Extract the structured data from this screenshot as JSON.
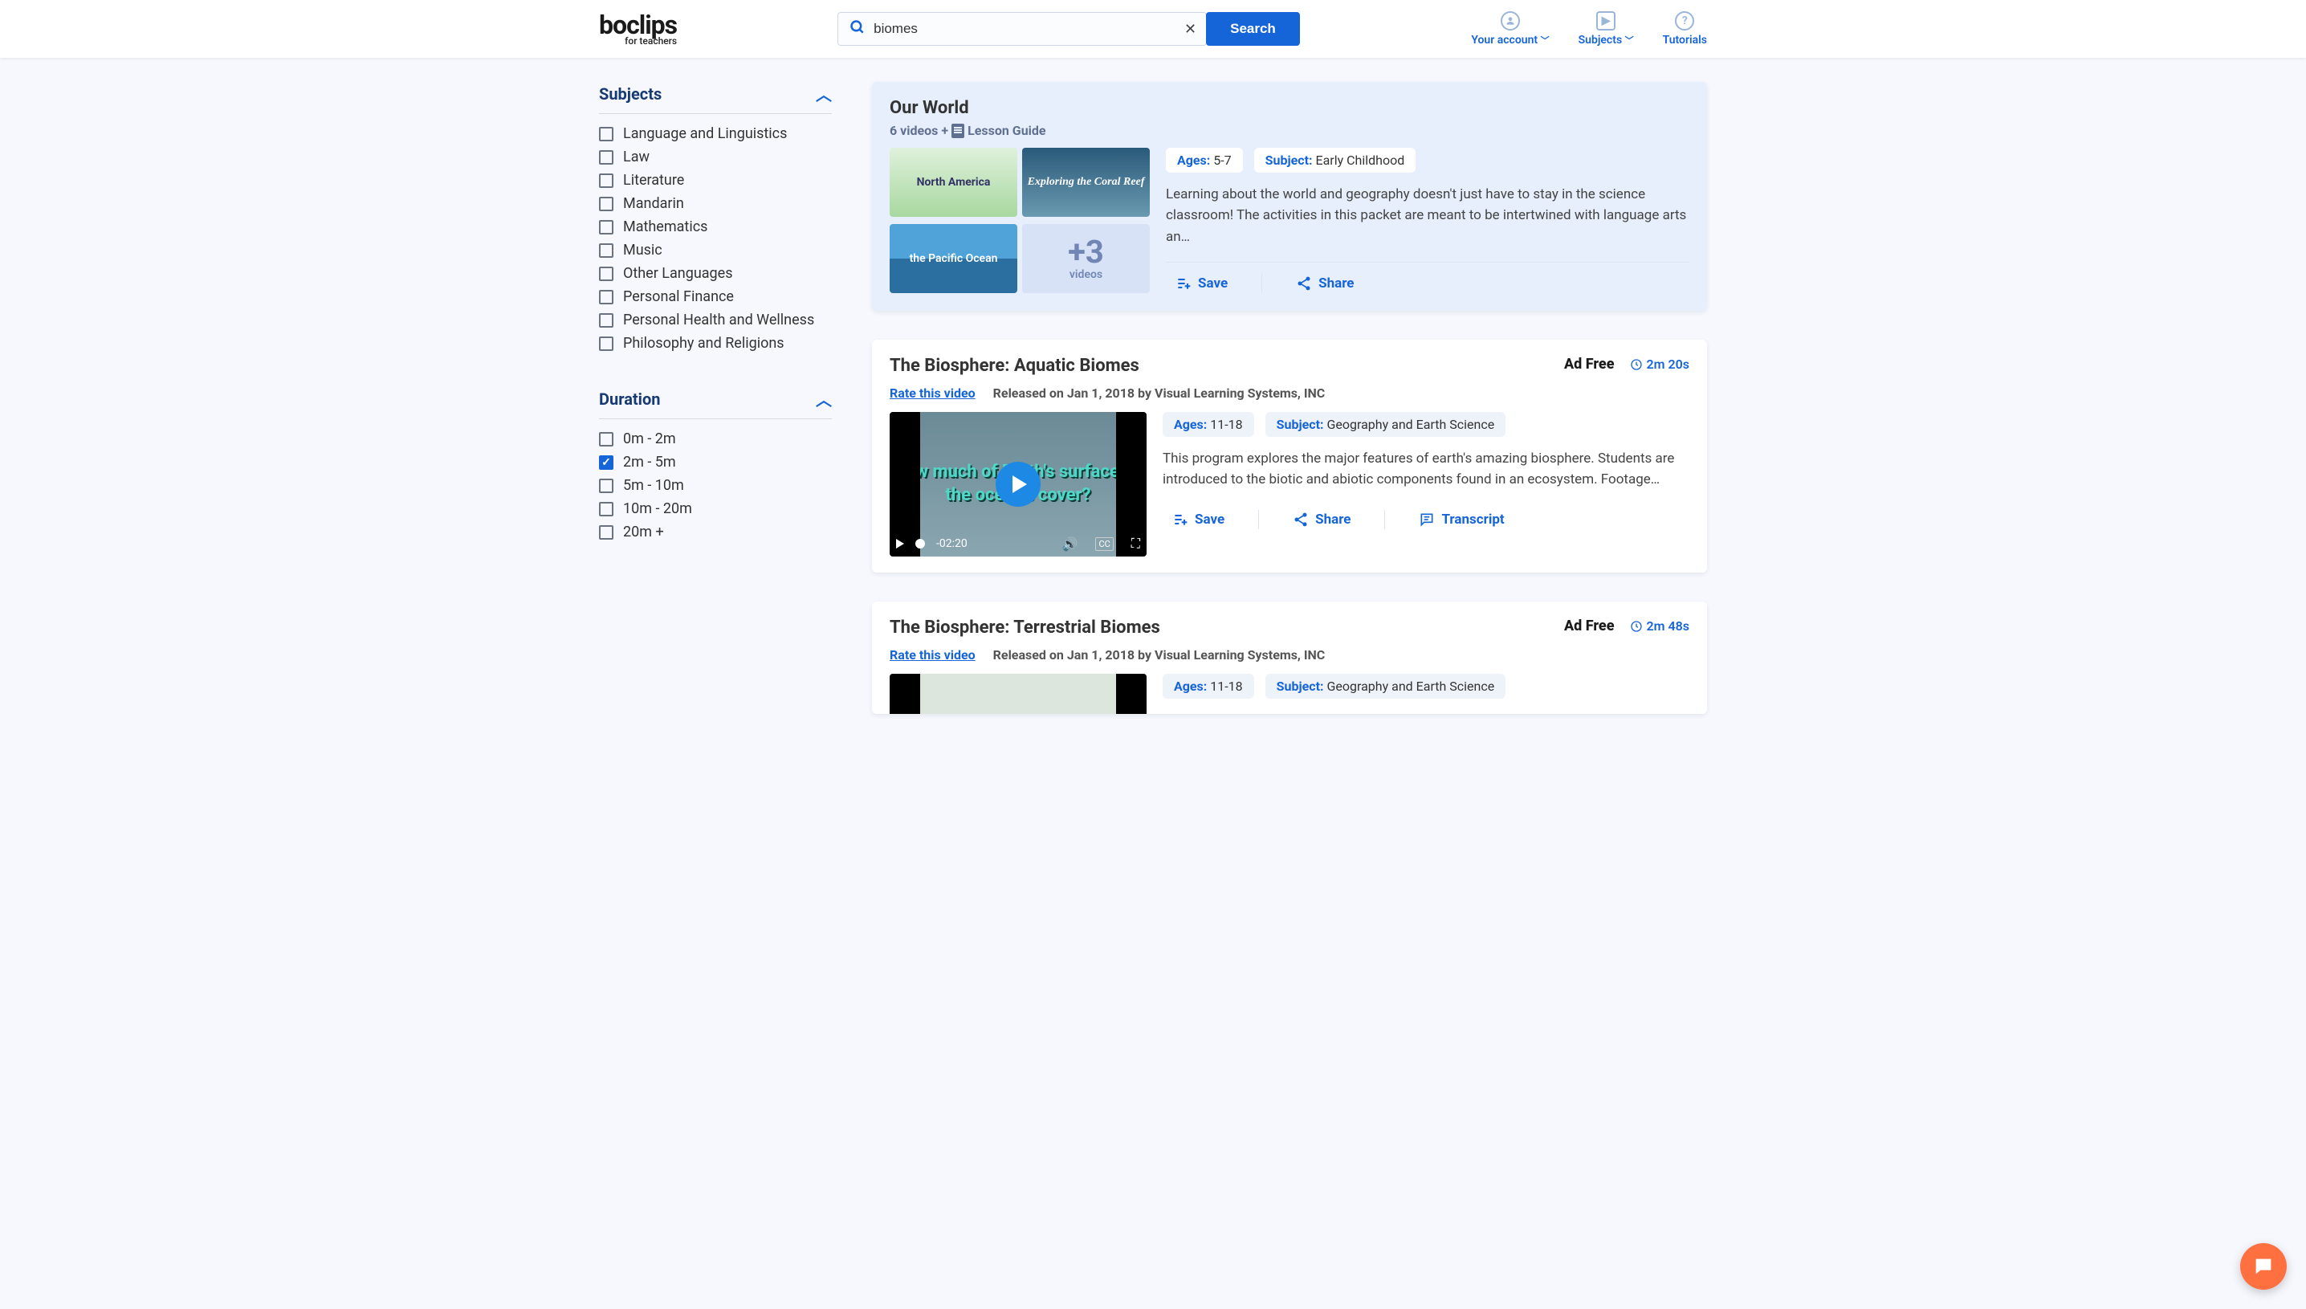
{
  "header": {
    "logo_main": "boclips",
    "logo_sub": "for teachers",
    "search_value": "biomes",
    "search_button": "Search",
    "nav": {
      "account": "Your account",
      "subjects": "Subjects",
      "tutorials": "Tutorials"
    }
  },
  "filters": {
    "subjects": {
      "title": "Subjects",
      "items": [
        {
          "label": "Language and Linguistics",
          "checked": false
        },
        {
          "label": "Law",
          "checked": false
        },
        {
          "label": "Literature",
          "checked": false
        },
        {
          "label": "Mandarin",
          "checked": false
        },
        {
          "label": "Mathematics",
          "checked": false
        },
        {
          "label": "Music",
          "checked": false
        },
        {
          "label": "Other Languages",
          "checked": false
        },
        {
          "label": "Personal Finance",
          "checked": false
        },
        {
          "label": "Personal Health and Wellness",
          "checked": false
        },
        {
          "label": "Philosophy and Religions",
          "checked": false
        }
      ]
    },
    "duration": {
      "title": "Duration",
      "items": [
        {
          "label": "0m - 2m",
          "checked": false
        },
        {
          "label": "2m - 5m",
          "checked": true
        },
        {
          "label": "5m - 10m",
          "checked": false
        },
        {
          "label": "10m - 20m",
          "checked": false
        },
        {
          "label": "20m +",
          "checked": false
        }
      ]
    }
  },
  "results": {
    "featured": {
      "title": "Our World",
      "subtitle_pre": "6 videos +",
      "subtitle_post": "Lesson Guide",
      "thumbs": [
        "North America",
        "Exploring the Coral Reef",
        "the Pacific Ocean"
      ],
      "more_count": "+3",
      "more_label": "videos",
      "ages_label": "Ages:",
      "ages_value": "5-7",
      "subject_label": "Subject:",
      "subject_value": "Early Childhood",
      "desc": "Learning about the world and geography doesn't just have to stay in the science classroom! The activities in this packet are meant to be intertwined with language arts an…",
      "save": "Save",
      "share": "Share"
    },
    "videos": [
      {
        "title": "The Biosphere: Aquatic Biomes",
        "adfree": "Ad Free",
        "duration": "2m 20s",
        "rate": "Rate this video",
        "released": "Released on Jan 1, 2018 by Visual Learning Systems, INC",
        "overlay": "How much of Earth's surface do the ocean's cover?",
        "time": "-02:20",
        "ages_label": "Ages:",
        "ages_value": "11-18",
        "subject_label": "Subject:",
        "subject_value": "Geography and Earth Science",
        "desc": "This program explores the major features of earth's amazing biosphere. Students are introduced to the biotic and abiotic components found in an ecosystem. Footage…",
        "save": "Save",
        "share": "Share",
        "transcript": "Transcript"
      },
      {
        "title": "The Biosphere: Terrestrial Biomes",
        "adfree": "Ad Free",
        "duration": "2m 48s",
        "rate": "Rate this video",
        "released": "Released on Jan 1, 2018 by Visual Learning Systems, INC",
        "ages_label": "Ages:",
        "ages_value": "11-18",
        "subject_label": "Subject:",
        "subject_value": "Geography and Earth Science"
      }
    ]
  }
}
